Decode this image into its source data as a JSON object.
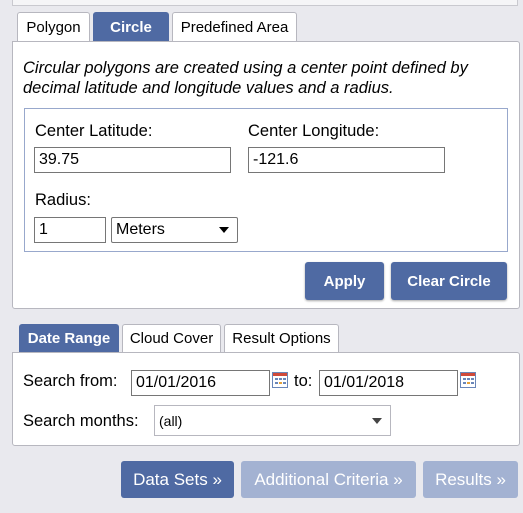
{
  "polygon_tabs": [
    {
      "label": "Polygon",
      "active": false
    },
    {
      "label": "Circle",
      "active": true
    },
    {
      "label": "Predefined Area",
      "active": false
    }
  ],
  "circle": {
    "description": "Circular polygons are created using a center point defined by decimal latitude and longitude values and a radius.",
    "center_latitude_label": "Center Latitude:",
    "center_latitude_value": "39.75",
    "center_longitude_label": "Center Longitude:",
    "center_longitude_value": "-121.6",
    "radius_label": "Radius:",
    "radius_value": "1",
    "radius_unit": "Meters",
    "apply_label": "Apply",
    "clear_label": "Clear Circle"
  },
  "date_tabs": [
    {
      "label": "Date Range",
      "active": true
    },
    {
      "label": "Cloud Cover",
      "active": false
    },
    {
      "label": "Result Options",
      "active": false
    }
  ],
  "date_range": {
    "search_from_label": "Search from:",
    "from_value": "01/01/2016",
    "to_label": "to:",
    "to_value": "01/01/2018",
    "months_label": "Search months:",
    "months_value": "(all)"
  },
  "nav": {
    "data_sets_label": "Data Sets »",
    "additional_label": "Additional Criteria »",
    "results_label": "Results »"
  },
  "colors": {
    "accent": "#4f6aa3",
    "accent_disabled": "#a3b2d2",
    "background": "#e9e9ee"
  }
}
